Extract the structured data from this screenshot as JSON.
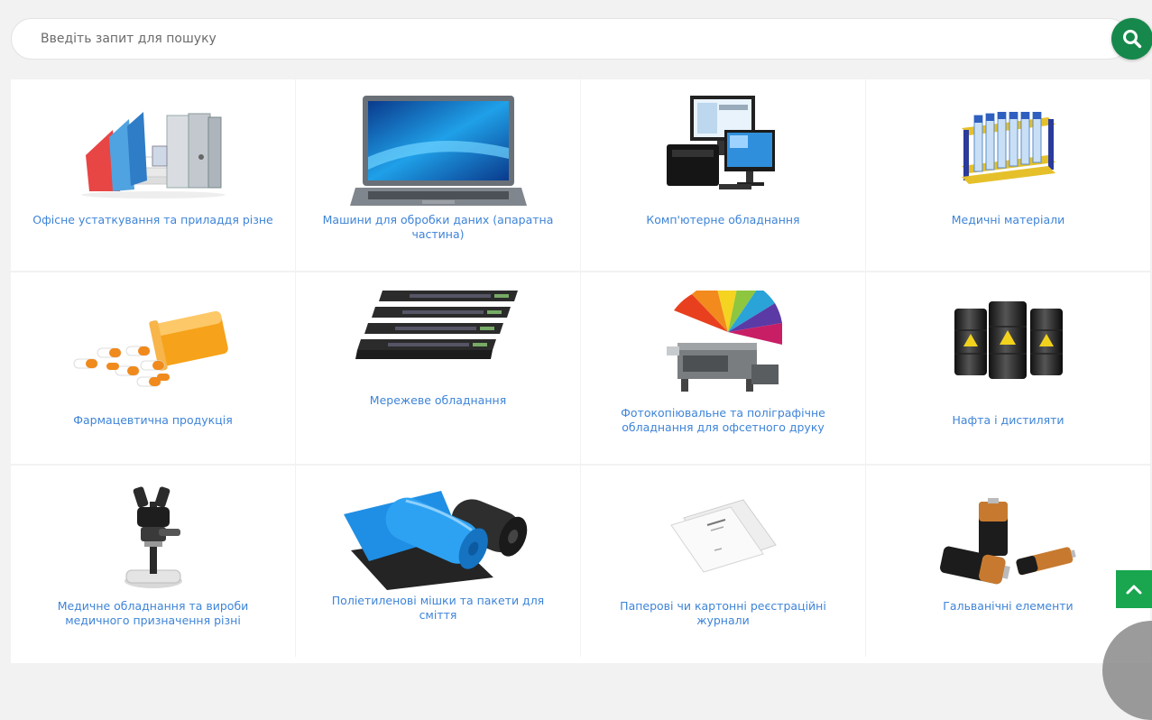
{
  "search": {
    "placeholder": "Введіть запит для пошуку",
    "icon": "search-icon",
    "button_color": "#16884b"
  },
  "categories": [
    {
      "label": "Офісне устаткування та приладдя різне",
      "icon": "office-supplies-image"
    },
    {
      "label": "Машини для обробки даних (апаратна частина)",
      "icon": "laptop-image"
    },
    {
      "label": "Комп'ютерне обладнання",
      "icon": "computer-equipment-image"
    },
    {
      "label": "Медичні матеріали",
      "icon": "test-tube-rack-image"
    },
    {
      "label": "Фармацевтична продукція",
      "icon": "pills-bottle-image"
    },
    {
      "label": "Мережеве обладнання",
      "icon": "network-switch-image"
    },
    {
      "label": "Фотокопіювальне та поліграфічне обладнання для офсетного друку",
      "icon": "printer-palette-image"
    },
    {
      "label": "Нафта і дистиляти",
      "icon": "oil-barrels-image"
    },
    {
      "label": "Медичне обладнання та вироби медичного призначення різні",
      "icon": "microscope-image"
    },
    {
      "label": "Поліетиленові мішки та пакети для сміття",
      "icon": "trash-bags-image"
    },
    {
      "label": "Паперові чи картонні реєстраційні журнали",
      "icon": "paper-journal-image"
    },
    {
      "label": "Гальванічні елементи",
      "icon": "batteries-image"
    }
  ],
  "scroll_top": {
    "icon": "chevron-up-icon",
    "color": "#19a64f"
  },
  "link_color": "#3e84d8"
}
